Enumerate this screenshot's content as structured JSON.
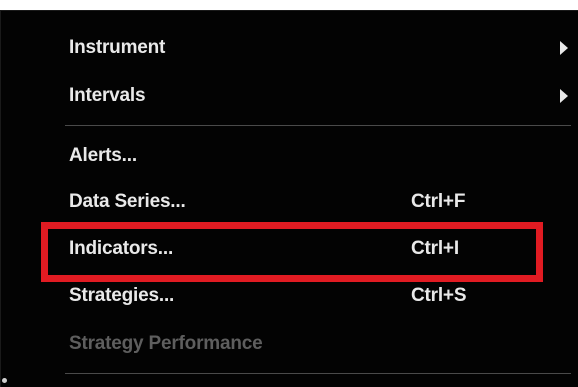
{
  "menu": {
    "items": [
      {
        "label": "Instrument",
        "shortcut": "",
        "has_submenu": true,
        "disabled": false
      },
      {
        "label": "Intervals",
        "shortcut": "",
        "has_submenu": true,
        "disabled": false
      },
      {
        "label": "Alerts...",
        "shortcut": "",
        "has_submenu": false,
        "disabled": false
      },
      {
        "label": "Data Series...",
        "shortcut": "Ctrl+F",
        "has_submenu": false,
        "disabled": false
      },
      {
        "label": "Indicators...",
        "shortcut": "Ctrl+I",
        "has_submenu": false,
        "disabled": false,
        "highlighted": true
      },
      {
        "label": "Strategies...",
        "shortcut": "Ctrl+S",
        "has_submenu": false,
        "disabled": false
      },
      {
        "label": "Strategy Performance",
        "shortcut": "",
        "has_submenu": false,
        "disabled": true
      }
    ]
  },
  "colors": {
    "menu_background": "#030303",
    "text": "#e9e9e9",
    "disabled_text": "#5e5e5e",
    "separator": "#4a4a4a",
    "highlight_box": "#e11b22"
  },
  "icons": {
    "submenu": "chevron-right-icon"
  }
}
